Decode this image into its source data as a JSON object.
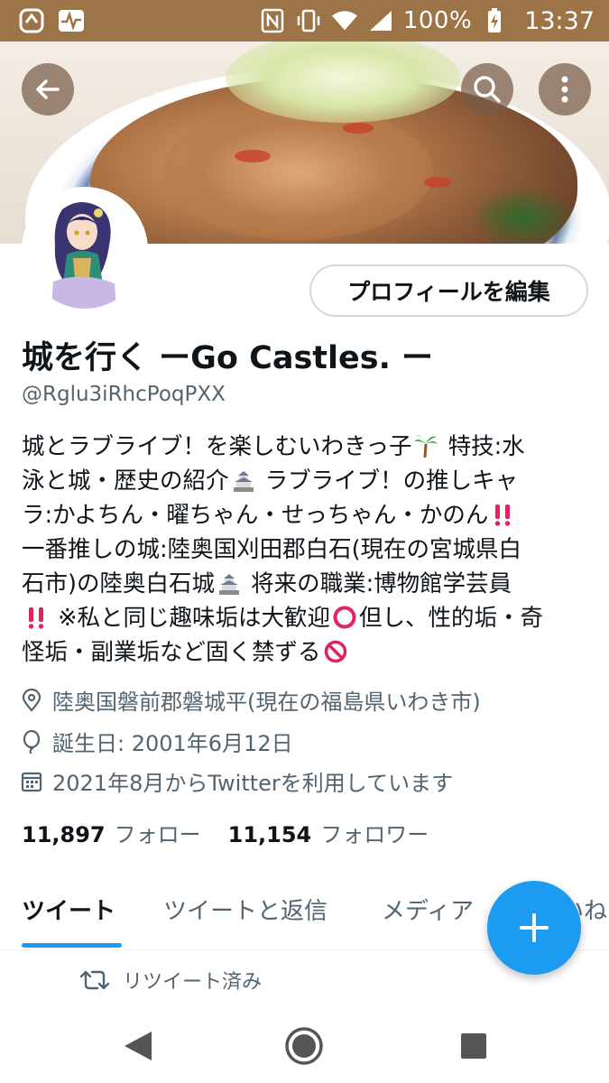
{
  "status_bar": {
    "battery": "100%",
    "time": "13:37"
  },
  "profile": {
    "display_name": "城を行く ーGo Castles. ー",
    "handle": "@Rglu3iRhcPoqPXX",
    "edit_profile_label": "プロフィールを編集",
    "bio_lines": [
      "城とラブライブ！を楽しむいわきっ子",
      "特技:水",
      "泳と城・歴史の紹介",
      "ラブライブ！の推しキャ",
      "ラ:かよちん・曜ちゃん・せっちゃん・かのん",
      "一番推しの城:陸奥国刈田郡白石(現在の宮城県白",
      "石市)の陸奥白石城",
      "将来の職業:博物館学芸員",
      "※私と同じ趣味垢は大歓迎",
      "但し、性的垢・奇",
      "怪垢・副業垢など固く禁ずる"
    ],
    "location": "陸奥国磐前郡磐城平(現在の福島県いわき市)",
    "birthday": "誕生日: 2001年6月12日",
    "joined": "2021年8月からTwitterを利用しています",
    "following_count": "11,897",
    "following_label": "フォロー",
    "followers_count": "11,154",
    "followers_label": "フォロワー"
  },
  "tabs": [
    {
      "label": "ツイート",
      "active": true
    },
    {
      "label": "ツイートと返信",
      "active": false
    },
    {
      "label": "メディア",
      "active": false
    },
    {
      "label": "いいね",
      "active": false
    }
  ],
  "retweet_label": "リツイート済み",
  "colors": {
    "accent": "#1d9bf0",
    "status_bar": "#9c7448",
    "text_primary": "#0f1419",
    "text_secondary": "#536471"
  },
  "icons": {
    "back": "arrow-left-icon",
    "search": "search-icon",
    "more": "more-vertical-icon",
    "location": "location-pin-icon",
    "birthday": "balloon-icon",
    "calendar": "calendar-icon",
    "compose": "plus-icon",
    "retweet": "retweet-icon"
  }
}
